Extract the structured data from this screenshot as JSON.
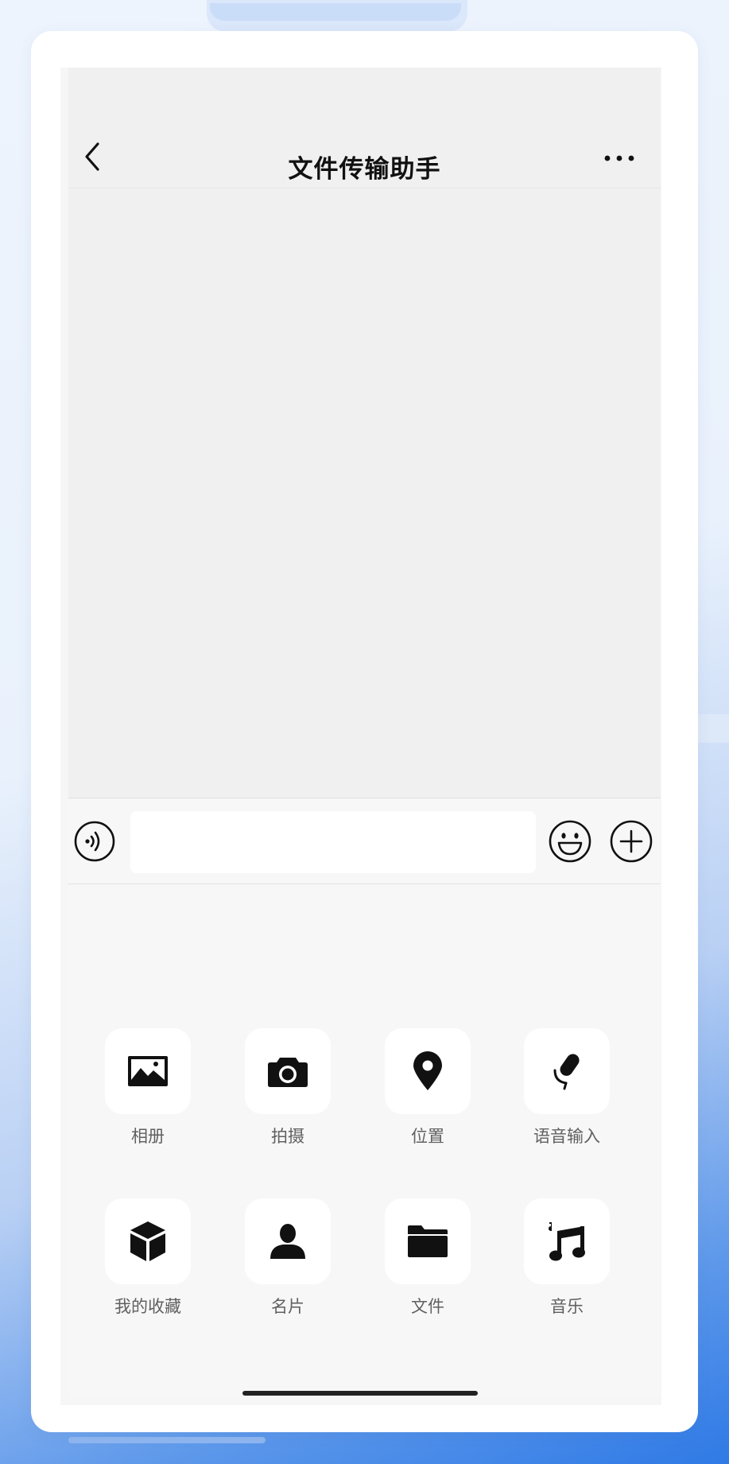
{
  "app": {
    "title": "文件传输助手",
    "colors": {
      "background_gradient_end": "#2f7ae6",
      "panel": "#f7f7f7",
      "chat_bg": "#f0f0f0",
      "icon": "#111111"
    }
  },
  "header": {
    "back_icon": "chevron-left-icon",
    "more_icon": "more-dots-icon"
  },
  "input_bar": {
    "voice_icon": "voice-icon",
    "message_value": "",
    "emoji_icon": "emoji-icon",
    "plus_icon": "plus-circle-icon"
  },
  "panel": {
    "items": [
      {
        "label": "相册",
        "icon": "photo-album-icon"
      },
      {
        "label": "拍摄",
        "icon": "camera-icon"
      },
      {
        "label": "位置",
        "icon": "location-pin-icon"
      },
      {
        "label": "语音输入",
        "icon": "microphone-icon"
      },
      {
        "label": "我的收藏",
        "icon": "favorites-box-icon"
      },
      {
        "label": "名片",
        "icon": "contact-card-icon"
      },
      {
        "label": "文件",
        "icon": "folder-icon"
      },
      {
        "label": "音乐",
        "icon": "music-note-icon"
      }
    ]
  }
}
